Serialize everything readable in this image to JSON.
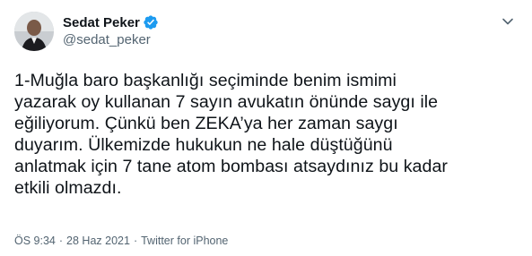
{
  "author": {
    "display_name": "Sedat Peker",
    "handle": "@sedat_peker",
    "verified_color": "#1d9bf0"
  },
  "tweet": {
    "lines": [
      "1-Muğla baro başkanlığı seçiminde benim ismimi",
      "yazarak oy kullanan 7 sayın avukatın önünde saygı ile",
      "eğiliyorum. Çünkü ben ZEKA’ya her zaman saygı",
      "duyarım. Ülkemizde hukukun ne hale düştüğünü",
      "anlatmak için 7 tane atom bombası atsaydınız bu kadar",
      "etkili olmazdı."
    ]
  },
  "meta": {
    "time": "ÖS 9:34",
    "separator": "·",
    "date": "28 Haz 2021",
    "source": "Twitter for iPhone"
  },
  "icons": {
    "more": "chevron-down-icon",
    "verified": "verified-badge-icon"
  }
}
